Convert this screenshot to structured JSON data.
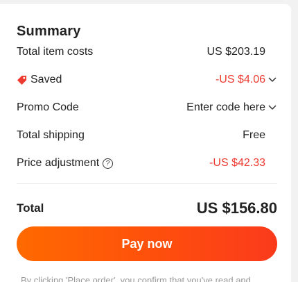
{
  "summary": {
    "title": "Summary",
    "total_item_costs": {
      "label": "Total item costs",
      "value": "US $203.19"
    },
    "saved": {
      "label": "Saved",
      "value": "-US $4.06"
    },
    "promo_code": {
      "label": "Promo Code",
      "value": "Enter code here"
    },
    "total_shipping": {
      "label": "Total shipping",
      "value": "Free"
    },
    "price_adjustment": {
      "label": "Price adjustment",
      "value": "-US $42.33"
    },
    "total": {
      "label": "Total",
      "value": "US $156.80"
    },
    "pay_button": "Pay now",
    "footnote": "By clicking 'Place order', you confirm that you've read and"
  },
  "colors": {
    "accent": "#ff4f0b",
    "discount": "#ee3a2f"
  },
  "icons": {
    "saved": "tag-icon",
    "dropdown": "chevron-down-icon",
    "help": "question-icon"
  }
}
